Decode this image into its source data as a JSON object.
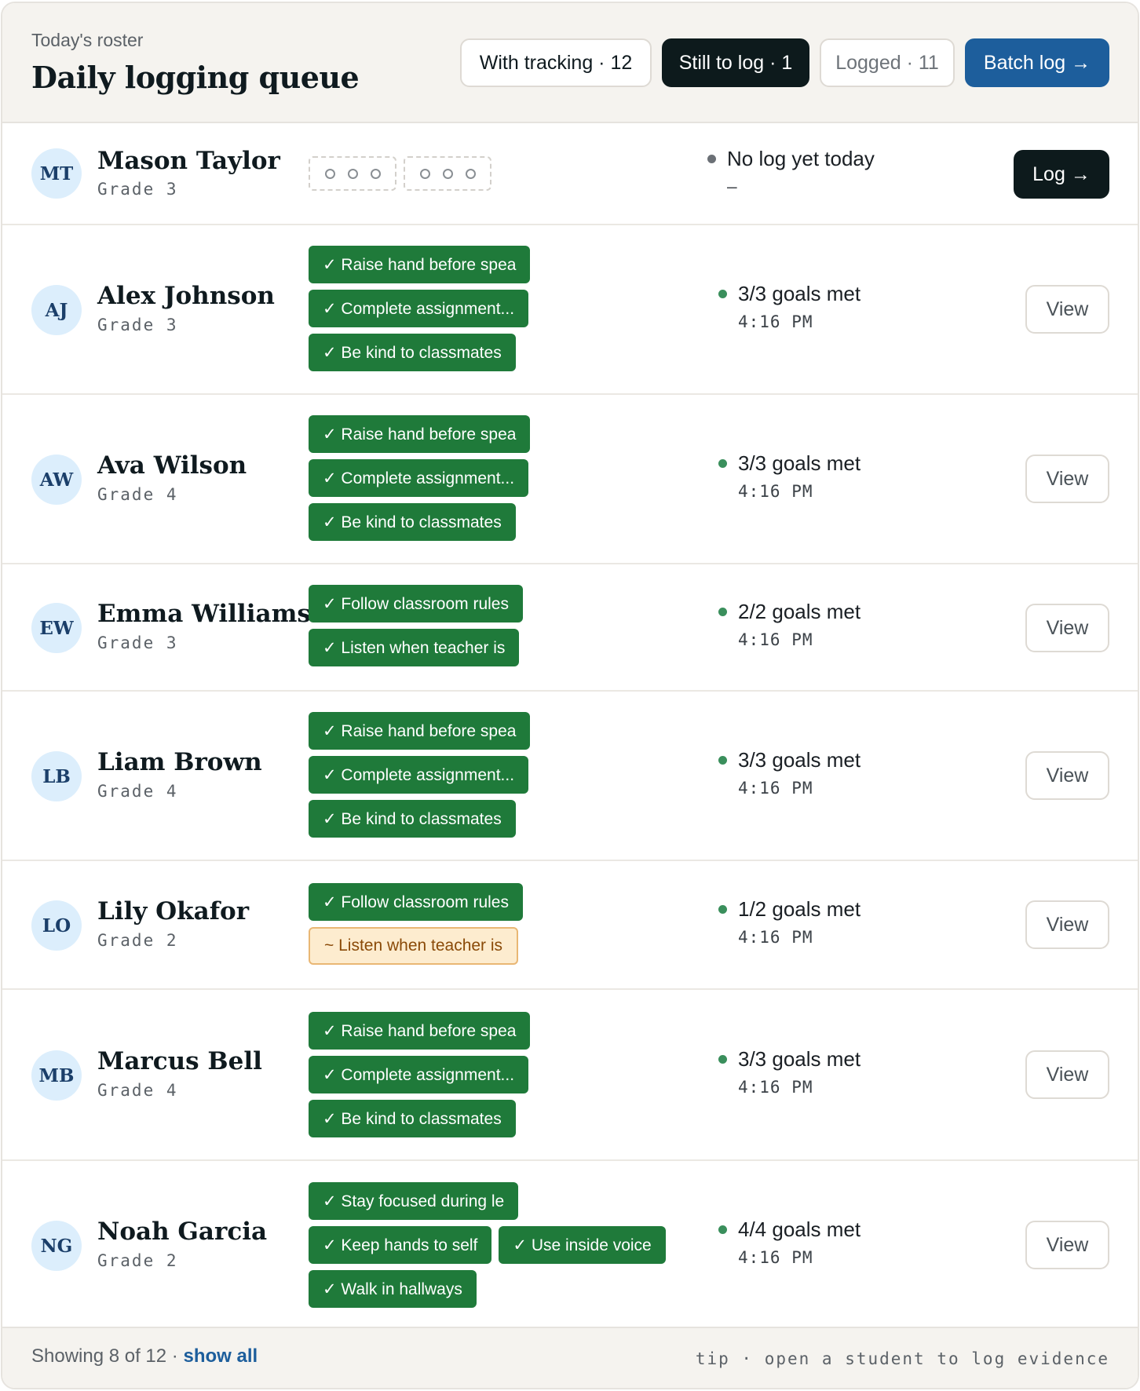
{
  "header": {
    "eyebrow": "Today's roster",
    "title": "Daily logging queue",
    "filters": [
      {
        "label": "With tracking · 12"
      },
      {
        "label": "Still to log · 1"
      },
      {
        "label": "Logged · 11"
      }
    ],
    "batch_label": "Batch log →"
  },
  "students": [
    {
      "initials": "MT",
      "name": "Mason Taylor",
      "grade": "Grade 3",
      "status": "No log yet today",
      "time": "—",
      "action": "Log →",
      "goals": []
    },
    {
      "initials": "AJ",
      "name": "Alex Johnson",
      "grade": "Grade 3",
      "status": "3/3 goals met",
      "time": "4:16 PM",
      "action": "View",
      "goals": [
        {
          "label": "✓ Raise hand before spea"
        },
        {
          "label": "✓ Complete assignment..."
        },
        {
          "label": "✓ Be kind to classmates"
        }
      ]
    },
    {
      "initials": "AW",
      "name": "Ava Wilson",
      "grade": "Grade 4",
      "status": "3/3 goals met",
      "time": "4:16 PM",
      "action": "View",
      "goals": [
        {
          "label": "✓ Raise hand before spea"
        },
        {
          "label": "✓ Complete assignment..."
        },
        {
          "label": "✓ Be kind to classmates"
        }
      ]
    },
    {
      "initials": "EW",
      "name": "Emma Williams",
      "grade": "Grade 3",
      "status": "2/2 goals met",
      "time": "4:16 PM",
      "action": "View",
      "goals": [
        {
          "label": "✓ Follow classroom rules"
        },
        {
          "label": "✓ Listen when teacher is"
        }
      ]
    },
    {
      "initials": "LB",
      "name": "Liam Brown",
      "grade": "Grade 4",
      "status": "3/3 goals met",
      "time": "4:16 PM",
      "action": "View",
      "goals": [
        {
          "label": "✓ Raise hand before spea"
        },
        {
          "label": "✓ Complete assignment..."
        },
        {
          "label": "✓ Be kind to classmates"
        }
      ]
    },
    {
      "initials": "LO",
      "name": "Lily Okafor",
      "grade": "Grade 2",
      "status": "1/2 goals met",
      "time": "4:16 PM",
      "action": "View",
      "goals": [
        {
          "label": "✓ Follow classroom rules"
        },
        {
          "label": "~ Listen when teacher is",
          "partial": true
        }
      ]
    },
    {
      "initials": "MB",
      "name": "Marcus Bell",
      "grade": "Grade 4",
      "status": "3/3 goals met",
      "time": "4:16 PM",
      "action": "View",
      "goals": [
        {
          "label": "✓ Raise hand before spea"
        },
        {
          "label": "✓ Complete assignment..."
        },
        {
          "label": "✓ Be kind to classmates"
        }
      ]
    },
    {
      "initials": "NG",
      "name": "Noah Garcia",
      "grade": "Grade 2",
      "status": "4/4 goals met",
      "time": "4:16 PM",
      "action": "View",
      "goals": [
        {
          "label": "✓ Stay focused during le"
        },
        {
          "label": "✓ Keep hands to self"
        },
        {
          "label": "✓ Use inside voice"
        },
        {
          "label": "✓ Walk in hallways"
        }
      ]
    }
  ],
  "footer": {
    "showing": "Showing 8 of 12 ·",
    "show_all": "show all",
    "tip": "tip · open a student to log evidence"
  },
  "colors": {
    "met": "#1f7a3a",
    "partial_bg": "#fdeccf",
    "primary": "#1d5e9c",
    "dark": "#0d1a1c"
  }
}
